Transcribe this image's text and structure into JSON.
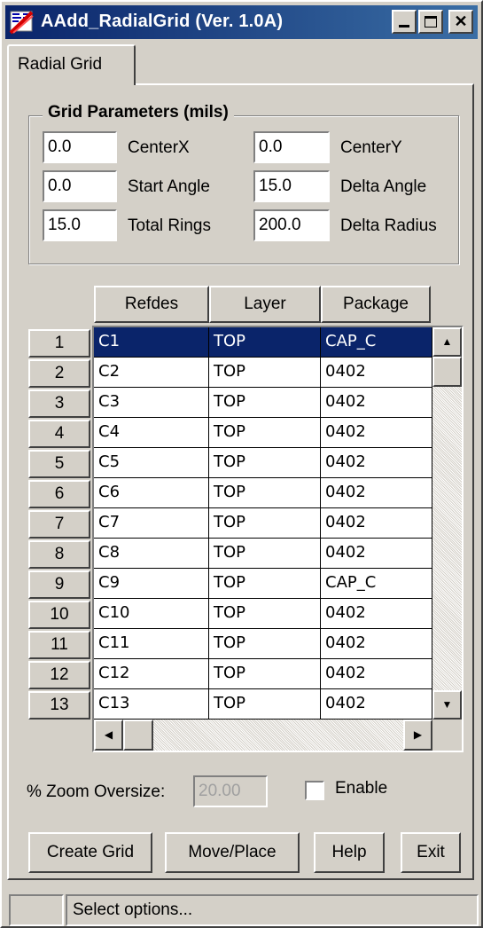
{
  "window": {
    "title": "AAdd_RadialGrid (Ver. 1.0A)",
    "icon": "radial-grid-app-icon",
    "controls": [
      "minimize-icon",
      "maximize-icon",
      "close-icon"
    ]
  },
  "tabs": [
    {
      "label": "Radial Grid",
      "active": true
    }
  ],
  "grid_parameters": {
    "legend": "Grid Parameters (mils)",
    "fields": [
      {
        "label": "CenterX",
        "value": "0.0"
      },
      {
        "label": "CenterY",
        "value": "0.0"
      },
      {
        "label": "Start Angle",
        "value": "0.0"
      },
      {
        "label": "Delta Angle",
        "value": "15.0"
      },
      {
        "label": "Total Rings",
        "value": "15.0"
      },
      {
        "label": "Delta Radius",
        "value": "200.0"
      }
    ]
  },
  "table": {
    "columns": [
      "Refdes",
      "Layer",
      "Package"
    ],
    "selected_row": 1,
    "rows": [
      {
        "num": "1",
        "refdes": "C1",
        "layer": "TOP",
        "package": "CAP_C"
      },
      {
        "num": "2",
        "refdes": "C2",
        "layer": "TOP",
        "package": "0402"
      },
      {
        "num": "3",
        "refdes": "C3",
        "layer": "TOP",
        "package": "0402"
      },
      {
        "num": "4",
        "refdes": "C4",
        "layer": "TOP",
        "package": "0402"
      },
      {
        "num": "5",
        "refdes": "C5",
        "layer": "TOP",
        "package": "0402"
      },
      {
        "num": "6",
        "refdes": "C6",
        "layer": "TOP",
        "package": "0402"
      },
      {
        "num": "7",
        "refdes": "C7",
        "layer": "TOP",
        "package": "0402"
      },
      {
        "num": "8",
        "refdes": "C8",
        "layer": "TOP",
        "package": "0402"
      },
      {
        "num": "9",
        "refdes": "C9",
        "layer": "TOP",
        "package": "CAP_C"
      },
      {
        "num": "10",
        "refdes": "C10",
        "layer": "TOP",
        "package": "0402"
      },
      {
        "num": "11",
        "refdes": "C11",
        "layer": "TOP",
        "package": "0402"
      },
      {
        "num": "12",
        "refdes": "C12",
        "layer": "TOP",
        "package": "0402"
      },
      {
        "num": "13",
        "refdes": "C13",
        "layer": "TOP",
        "package": "0402"
      }
    ]
  },
  "zoom": {
    "label": "% Zoom Oversize:",
    "value": "20.00",
    "enabled": false,
    "enable_label": "Enable"
  },
  "buttons": {
    "create_grid": "Create Grid",
    "move_place": "Move/Place",
    "help": "Help",
    "exit": "Exit"
  },
  "status": {
    "message": "Select options..."
  },
  "colors": {
    "face": "#d4d0c8",
    "title_start": "#0a246a",
    "title_end": "#3a6ea5",
    "selection": "#0a246a"
  }
}
